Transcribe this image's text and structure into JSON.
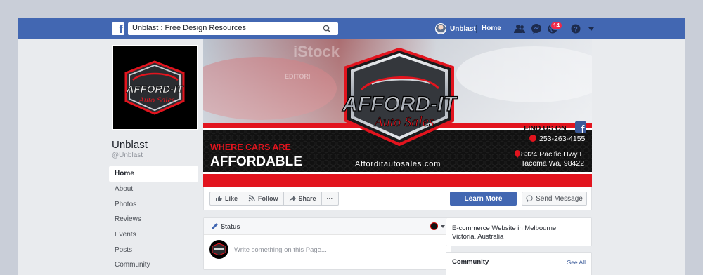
{
  "topbar": {
    "logo_letter": "f",
    "search_value": "Unblast : Free Design Resources",
    "user_name": "Unblast",
    "home_label": "Home",
    "notifications_count": "14",
    "icons": [
      "find-friends-icon",
      "messenger-icon",
      "globe-notifications-icon",
      "help-icon",
      "caret-down-icon"
    ]
  },
  "page": {
    "name": "Unblast",
    "handle": "@Unblast"
  },
  "sidebar": {
    "items": [
      {
        "label": "Home"
      },
      {
        "label": "About"
      },
      {
        "label": "Photos"
      },
      {
        "label": "Reviews"
      },
      {
        "label": "Events"
      },
      {
        "label": "Posts"
      },
      {
        "label": "Community"
      }
    ]
  },
  "cover": {
    "logo_line1": "AFFORD-IT",
    "logo_line2": "Auto Sales",
    "watermark_brand": "iStock",
    "watermark_sub": "EDITORI",
    "find_us": "FIND US ON",
    "tagline_top": "WHERE CARS ARE",
    "tagline_bottom": "AFFORDABLE",
    "website": "Afforditautosales.com",
    "phone": "253-263-4155",
    "address_line1": "8324 Pacific Hwy E",
    "address_line2": "Tacoma Wa, 98422",
    "colors": {
      "red": "#e2141e",
      "dark": "#111111",
      "silver": "#c9cdd3"
    }
  },
  "actions": {
    "like": "Like",
    "follow": "Follow",
    "share": "Share",
    "more": "···",
    "learn_more": "Learn More",
    "send_message": "Send Message"
  },
  "status": {
    "label": "Status",
    "placeholder": "Write something on this Page..."
  },
  "about": {
    "line1": "E-commerce Website in Melbourne,",
    "line2": "Victoria, Australia"
  },
  "community": {
    "title": "Community",
    "see_all": "See All"
  },
  "colors": {
    "facebook_blue": "#4267b2",
    "page_bg": "#e9ebee",
    "outer_bg": "#c9ced8",
    "badge_red": "#f02849"
  }
}
